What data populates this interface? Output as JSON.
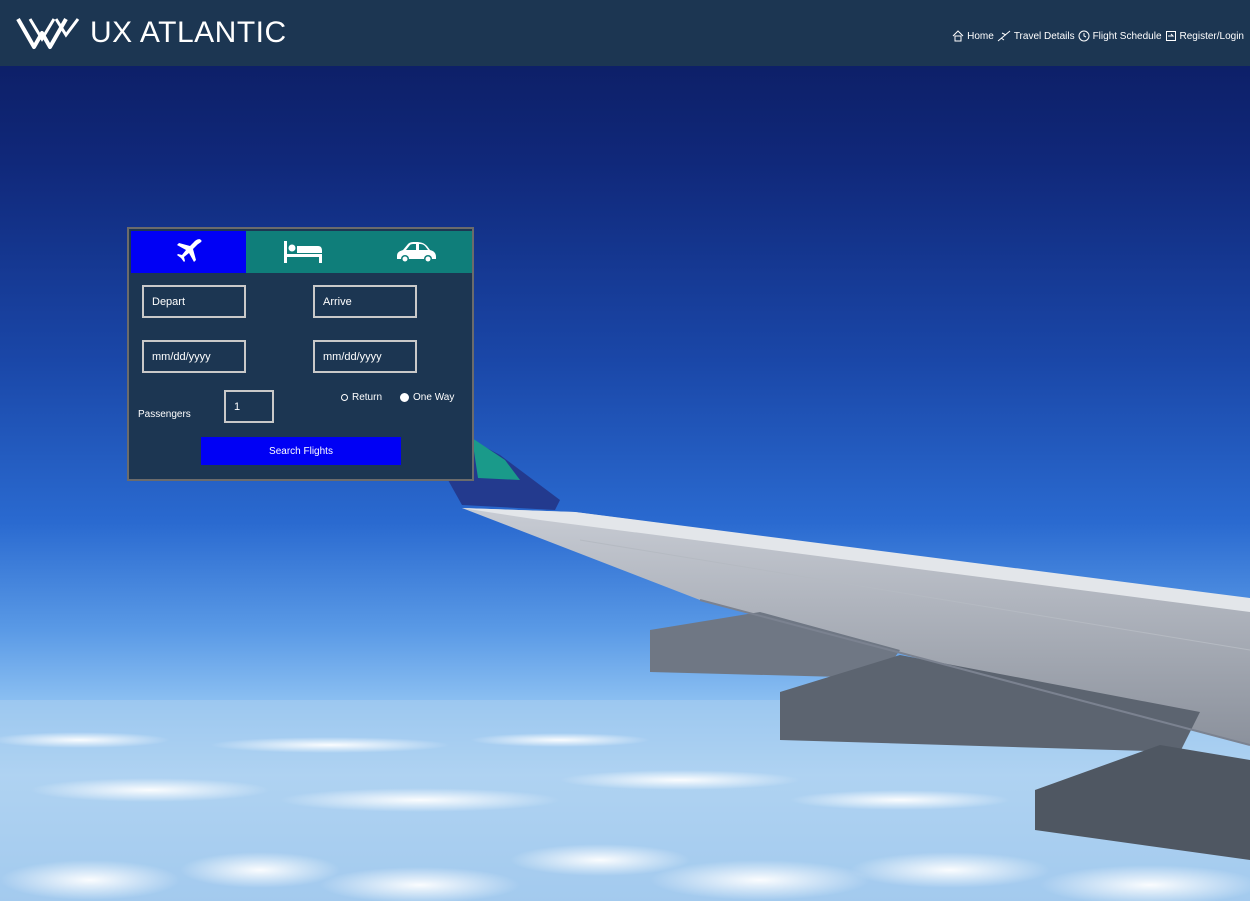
{
  "header": {
    "brand": "UX ATLANTIC",
    "nav": [
      {
        "label": "Home",
        "icon": "home-icon"
      },
      {
        "label": "Travel Details",
        "icon": "plane-icon"
      },
      {
        "label": "Flight Schedule",
        "icon": "clock-icon"
      },
      {
        "label": "Register/Login",
        "icon": "login-icon"
      }
    ]
  },
  "booking": {
    "tabs": [
      {
        "name": "flight",
        "icon": "plane-icon",
        "active": true
      },
      {
        "name": "hotel",
        "icon": "bed-icon",
        "active": false
      },
      {
        "name": "car",
        "icon": "car-icon",
        "active": false
      }
    ],
    "depart_placeholder": "Depart",
    "arrive_placeholder": "Arrive",
    "depart_date_placeholder": "mm/dd/yyyy",
    "arrive_date_placeholder": "mm/dd/yyyy",
    "passengers_label": "Passengers",
    "passengers_value": "1",
    "trip_options": [
      {
        "label": "Return",
        "selected": false
      },
      {
        "label": "One Way",
        "selected": true
      }
    ],
    "search_label": "Search Flights"
  },
  "colors": {
    "header_bg": "#1c3652",
    "accent_blue": "#0000f5",
    "tab_teal": "#0f7e7a"
  }
}
